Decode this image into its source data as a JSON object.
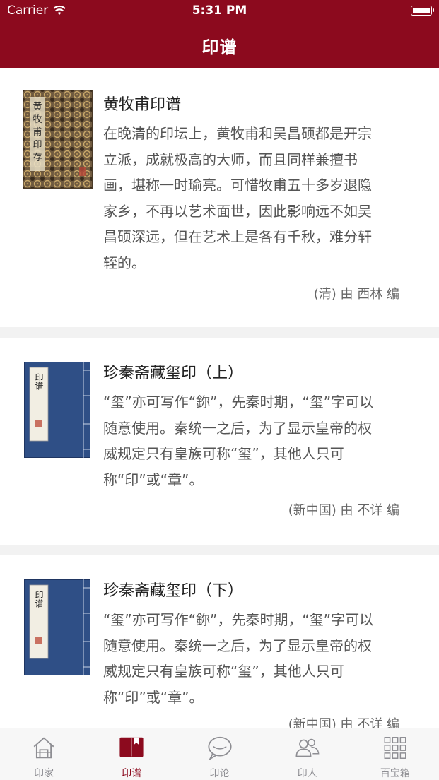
{
  "status_bar": {
    "carrier": "Carrier",
    "time": "5:31 PM"
  },
  "nav": {
    "title": "印谱"
  },
  "books": [
    {
      "title": "黄牧甫印谱",
      "lines": [
        "在晚清的印坛上，黄牧甫和吴昌硕都是开宗",
        "立派，成就极高的大师，而且同样兼擅书",
        "画，堪称一时瑜亮。可惜牧甫五十多岁退隐",
        "家乡，不再以艺术面世，因此影响远不如吴",
        "昌硕深远，但在艺术上是各有千秋，难分轩",
        "轾的。"
      ],
      "meta": "(清) 由 西林 编",
      "cover": "patterned-book-cover"
    },
    {
      "title": "珍秦斋藏玺印（上）",
      "lines": [
        "“玺”亦可写作“鉨”，先秦时期，“玺”字可以",
        "随意使用。秦统一之后，为了显示皇帝的权",
        "威规定只有皇族可称“玺”，其他人只可",
        "称“印”或“章”。"
      ],
      "meta": "(新中国) 由 不详 编",
      "cover": "blue-book-cover",
      "cover_label": "印谱"
    },
    {
      "title": "珍秦斋藏玺印（下）",
      "lines": [
        "“玺”亦可写作“鉨”，先秦时期，“玺”字可以",
        "随意使用。秦统一之后，为了显示皇帝的权",
        "威规定只有皇族可称“玺”，其他人只可",
        "称“印”或“章”。"
      ],
      "meta": "(新中国) 由 不详 编",
      "cover": "blue-book-cover",
      "cover_label": "印谱"
    }
  ],
  "tabs": [
    {
      "label": "印家",
      "icon": "house-icon",
      "active": false
    },
    {
      "label": "印谱",
      "icon": "book-icon",
      "active": true
    },
    {
      "label": "印论",
      "icon": "chat-bubble-icon",
      "active": false
    },
    {
      "label": "印人",
      "icon": "people-icon",
      "active": false
    },
    {
      "label": "百宝箱",
      "icon": "grid-icon",
      "active": false
    }
  ],
  "colors": {
    "brand": "#8c0a1e",
    "inactive_tab": "#8e8e93"
  }
}
